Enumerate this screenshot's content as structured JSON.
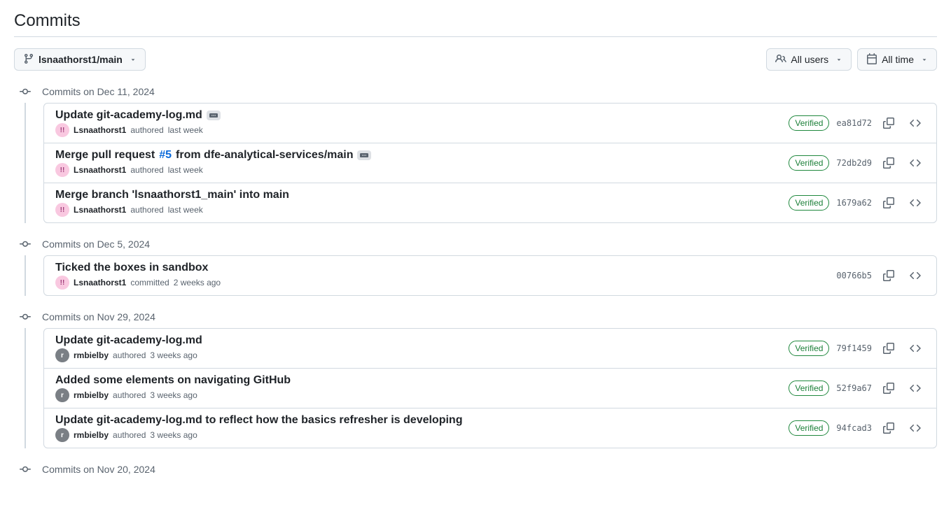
{
  "page_title": "Commits",
  "toolbar": {
    "branch": "lsnaathorst1/main",
    "users_filter": "All users",
    "time_filter": "All time"
  },
  "verified_label": "Verified",
  "groups": [
    {
      "date_label": "Commits on Dec 11, 2024",
      "commits": [
        {
          "title_parts": [
            {
              "text": "Update git-academy-log.md"
            }
          ],
          "has_expand": true,
          "author": "Lsnaathorst1",
          "avatar_class": "avatar-pink",
          "avatar_initials": "!!",
          "action": "authored",
          "time": "last week",
          "verified": true,
          "sha": "ea81d72"
        },
        {
          "title_parts": [
            {
              "text": "Merge pull request "
            },
            {
              "text": "#5",
              "link": true
            },
            {
              "text": " from dfe-analytical-services/main"
            }
          ],
          "has_expand": true,
          "author": "Lsnaathorst1",
          "avatar_class": "avatar-pink",
          "avatar_initials": "!!",
          "action": "authored",
          "time": "last week",
          "verified": true,
          "sha": "72db2d9"
        },
        {
          "title_parts": [
            {
              "text": "Merge branch 'lsnaathorst1_main' into main"
            }
          ],
          "has_expand": false,
          "author": "Lsnaathorst1",
          "avatar_class": "avatar-pink",
          "avatar_initials": "!!",
          "action": "authored",
          "time": "last week",
          "verified": true,
          "sha": "1679a62"
        }
      ]
    },
    {
      "date_label": "Commits on Dec 5, 2024",
      "commits": [
        {
          "title_parts": [
            {
              "text": "Ticked the boxes in sandbox"
            }
          ],
          "has_expand": false,
          "author": "Lsnaathorst1",
          "avatar_class": "avatar-pink",
          "avatar_initials": "!!",
          "action": "committed",
          "time": "2 weeks ago",
          "verified": false,
          "sha": "00766b5"
        }
      ]
    },
    {
      "date_label": "Commits on Nov 29, 2024",
      "commits": [
        {
          "title_parts": [
            {
              "text": "Update git-academy-log.md"
            }
          ],
          "has_expand": false,
          "author": "rmbielby",
          "avatar_class": "avatar-gray",
          "avatar_initials": "r",
          "action": "authored",
          "time": "3 weeks ago",
          "verified": true,
          "sha": "79f1459"
        },
        {
          "title_parts": [
            {
              "text": "Added some elements on navigating GitHub"
            }
          ],
          "has_expand": false,
          "author": "rmbielby",
          "avatar_class": "avatar-gray",
          "avatar_initials": "r",
          "action": "authored",
          "time": "3 weeks ago",
          "verified": true,
          "sha": "52f9a67"
        },
        {
          "title_parts": [
            {
              "text": "Update git-academy-log.md to reflect how the basics refresher is developing"
            }
          ],
          "has_expand": false,
          "author": "rmbielby",
          "avatar_class": "avatar-gray",
          "avatar_initials": "r",
          "action": "authored",
          "time": "3 weeks ago",
          "verified": true,
          "sha": "94fcad3"
        }
      ]
    },
    {
      "date_label": "Commits on Nov 20, 2024",
      "commits": []
    }
  ]
}
